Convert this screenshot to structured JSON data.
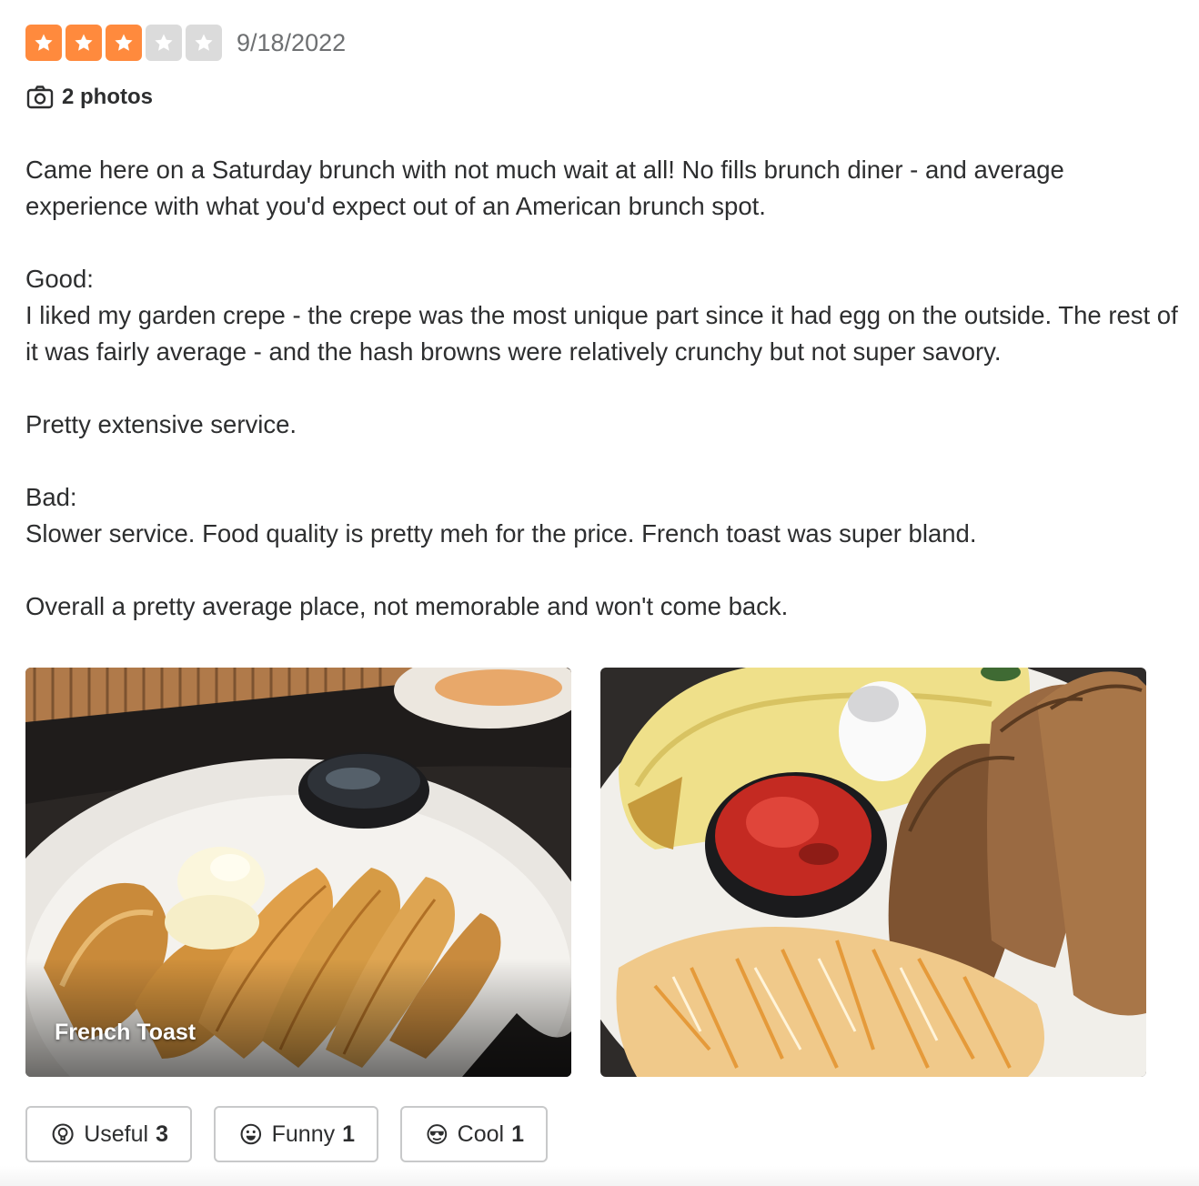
{
  "review": {
    "rating": 3,
    "rating_max": 5,
    "date": "9/18/2022",
    "photos_label": "2 photos",
    "paragraphs": [
      "Came here on a Saturday brunch with not much wait at all! No fills brunch diner - and average experience with what you'd expect out of an American brunch spot.",
      "Good:\nI liked my garden crepe - the crepe was the most unique part since it had egg on the outside. The rest of it was fairly average - and the hash browns were relatively crunchy but not super savory.",
      "Pretty extensive service.",
      "Bad:\nSlower service. Food quality is pretty meh for the price. French toast was super bland.",
      "Overall a pretty average place, not memorable and won't come back."
    ],
    "photos": [
      {
        "caption": "French Toast"
      },
      {
        "caption": ""
      }
    ],
    "reactions": {
      "useful": {
        "label": "Useful",
        "count": "3"
      },
      "funny": {
        "label": "Funny",
        "count": "1"
      },
      "cool": {
        "label": "Cool",
        "count": "1"
      }
    }
  },
  "icons": {
    "star": "star-icon",
    "camera": "camera-icon",
    "useful": "lightbulb-icon",
    "funny": "smile-icon",
    "cool": "sunglasses-icon"
  },
  "colors": {
    "star_filled": "#ff8a3d",
    "star_empty": "#dbdbdb",
    "text": "#2d2e2f",
    "muted": "#6e7072",
    "border": "#c8c9ca"
  }
}
